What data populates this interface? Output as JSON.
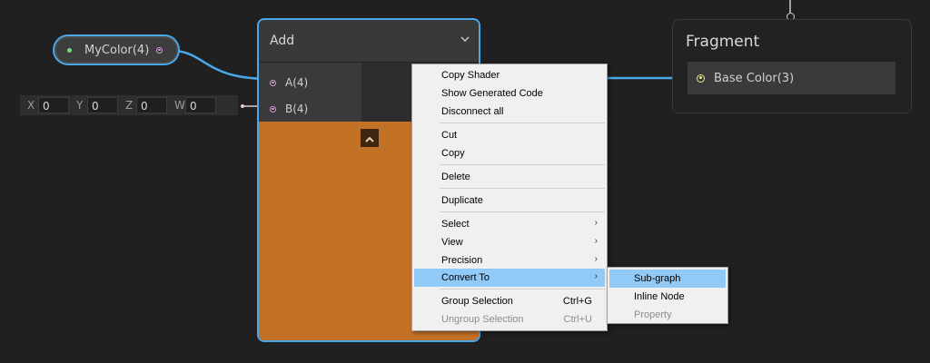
{
  "property_node": {
    "label": "MyColor(4)"
  },
  "vector_field": {
    "components": [
      {
        "label": "X",
        "value": "0"
      },
      {
        "label": "Y",
        "value": "0"
      },
      {
        "label": "Z",
        "value": "0"
      },
      {
        "label": "W",
        "value": "0"
      }
    ]
  },
  "add_node": {
    "title": "Add",
    "inputs": [
      {
        "label": "A(4)"
      },
      {
        "label": "B(4)"
      }
    ],
    "preview_color": "#c37126"
  },
  "fragment_node": {
    "title": "Fragment",
    "port": {
      "label": "Base Color(3)"
    }
  },
  "context_menu": {
    "items": [
      {
        "label": "Copy Shader"
      },
      {
        "label": "Show Generated Code"
      },
      {
        "label": "Disconnect all"
      },
      {
        "label": "Cut"
      },
      {
        "label": "Copy"
      },
      {
        "label": "Delete"
      },
      {
        "label": "Duplicate"
      },
      {
        "label": "Select"
      },
      {
        "label": "View"
      },
      {
        "label": "Precision"
      },
      {
        "label": "Convert To"
      },
      {
        "label": "Group Selection",
        "shortcut": "Ctrl+G"
      },
      {
        "label": "Ungroup Selection",
        "shortcut": "Ctrl+U"
      }
    ],
    "submenu": [
      {
        "label": "Sub-graph"
      },
      {
        "label": "Inline Node"
      },
      {
        "label": "Property"
      }
    ]
  },
  "colors": {
    "selection_border": "#4aa7e8",
    "wire": "#4aa7e8",
    "menu_highlight": "#91c9f7",
    "canvas": "#202020"
  },
  "icons": {
    "add_node_chevron": "chevron-down-icon",
    "collapse_preview": "chevron-up-icon",
    "submenu_arrow": "chevron-right-icon"
  }
}
